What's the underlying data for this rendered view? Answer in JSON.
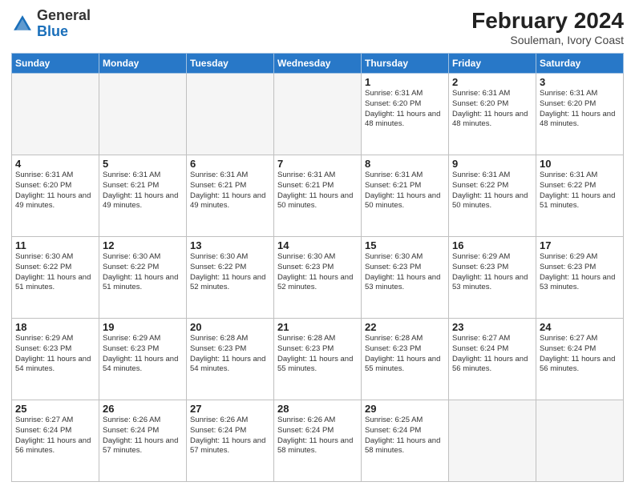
{
  "header": {
    "logo_general": "General",
    "logo_blue": "Blue",
    "month_year": "February 2024",
    "location": "Souleman, Ivory Coast"
  },
  "days_of_week": [
    "Sunday",
    "Monday",
    "Tuesday",
    "Wednesday",
    "Thursday",
    "Friday",
    "Saturday"
  ],
  "weeks": [
    [
      {
        "day": "",
        "info": ""
      },
      {
        "day": "",
        "info": ""
      },
      {
        "day": "",
        "info": ""
      },
      {
        "day": "",
        "info": ""
      },
      {
        "day": "1",
        "info": "Sunrise: 6:31 AM\nSunset: 6:20 PM\nDaylight: 11 hours and 48 minutes."
      },
      {
        "day": "2",
        "info": "Sunrise: 6:31 AM\nSunset: 6:20 PM\nDaylight: 11 hours and 48 minutes."
      },
      {
        "day": "3",
        "info": "Sunrise: 6:31 AM\nSunset: 6:20 PM\nDaylight: 11 hours and 48 minutes."
      }
    ],
    [
      {
        "day": "4",
        "info": "Sunrise: 6:31 AM\nSunset: 6:20 PM\nDaylight: 11 hours and 49 minutes."
      },
      {
        "day": "5",
        "info": "Sunrise: 6:31 AM\nSunset: 6:21 PM\nDaylight: 11 hours and 49 minutes."
      },
      {
        "day": "6",
        "info": "Sunrise: 6:31 AM\nSunset: 6:21 PM\nDaylight: 11 hours and 49 minutes."
      },
      {
        "day": "7",
        "info": "Sunrise: 6:31 AM\nSunset: 6:21 PM\nDaylight: 11 hours and 50 minutes."
      },
      {
        "day": "8",
        "info": "Sunrise: 6:31 AM\nSunset: 6:21 PM\nDaylight: 11 hours and 50 minutes."
      },
      {
        "day": "9",
        "info": "Sunrise: 6:31 AM\nSunset: 6:22 PM\nDaylight: 11 hours and 50 minutes."
      },
      {
        "day": "10",
        "info": "Sunrise: 6:31 AM\nSunset: 6:22 PM\nDaylight: 11 hours and 51 minutes."
      }
    ],
    [
      {
        "day": "11",
        "info": "Sunrise: 6:30 AM\nSunset: 6:22 PM\nDaylight: 11 hours and 51 minutes."
      },
      {
        "day": "12",
        "info": "Sunrise: 6:30 AM\nSunset: 6:22 PM\nDaylight: 11 hours and 51 minutes."
      },
      {
        "day": "13",
        "info": "Sunrise: 6:30 AM\nSunset: 6:22 PM\nDaylight: 11 hours and 52 minutes."
      },
      {
        "day": "14",
        "info": "Sunrise: 6:30 AM\nSunset: 6:23 PM\nDaylight: 11 hours and 52 minutes."
      },
      {
        "day": "15",
        "info": "Sunrise: 6:30 AM\nSunset: 6:23 PM\nDaylight: 11 hours and 53 minutes."
      },
      {
        "day": "16",
        "info": "Sunrise: 6:29 AM\nSunset: 6:23 PM\nDaylight: 11 hours and 53 minutes."
      },
      {
        "day": "17",
        "info": "Sunrise: 6:29 AM\nSunset: 6:23 PM\nDaylight: 11 hours and 53 minutes."
      }
    ],
    [
      {
        "day": "18",
        "info": "Sunrise: 6:29 AM\nSunset: 6:23 PM\nDaylight: 11 hours and 54 minutes."
      },
      {
        "day": "19",
        "info": "Sunrise: 6:29 AM\nSunset: 6:23 PM\nDaylight: 11 hours and 54 minutes."
      },
      {
        "day": "20",
        "info": "Sunrise: 6:28 AM\nSunset: 6:23 PM\nDaylight: 11 hours and 54 minutes."
      },
      {
        "day": "21",
        "info": "Sunrise: 6:28 AM\nSunset: 6:23 PM\nDaylight: 11 hours and 55 minutes."
      },
      {
        "day": "22",
        "info": "Sunrise: 6:28 AM\nSunset: 6:23 PM\nDaylight: 11 hours and 55 minutes."
      },
      {
        "day": "23",
        "info": "Sunrise: 6:27 AM\nSunset: 6:24 PM\nDaylight: 11 hours and 56 minutes."
      },
      {
        "day": "24",
        "info": "Sunrise: 6:27 AM\nSunset: 6:24 PM\nDaylight: 11 hours and 56 minutes."
      }
    ],
    [
      {
        "day": "25",
        "info": "Sunrise: 6:27 AM\nSunset: 6:24 PM\nDaylight: 11 hours and 56 minutes."
      },
      {
        "day": "26",
        "info": "Sunrise: 6:26 AM\nSunset: 6:24 PM\nDaylight: 11 hours and 57 minutes."
      },
      {
        "day": "27",
        "info": "Sunrise: 6:26 AM\nSunset: 6:24 PM\nDaylight: 11 hours and 57 minutes."
      },
      {
        "day": "28",
        "info": "Sunrise: 6:26 AM\nSunset: 6:24 PM\nDaylight: 11 hours and 58 minutes."
      },
      {
        "day": "29",
        "info": "Sunrise: 6:25 AM\nSunset: 6:24 PM\nDaylight: 11 hours and 58 minutes."
      },
      {
        "day": "",
        "info": ""
      },
      {
        "day": "",
        "info": ""
      }
    ]
  ]
}
